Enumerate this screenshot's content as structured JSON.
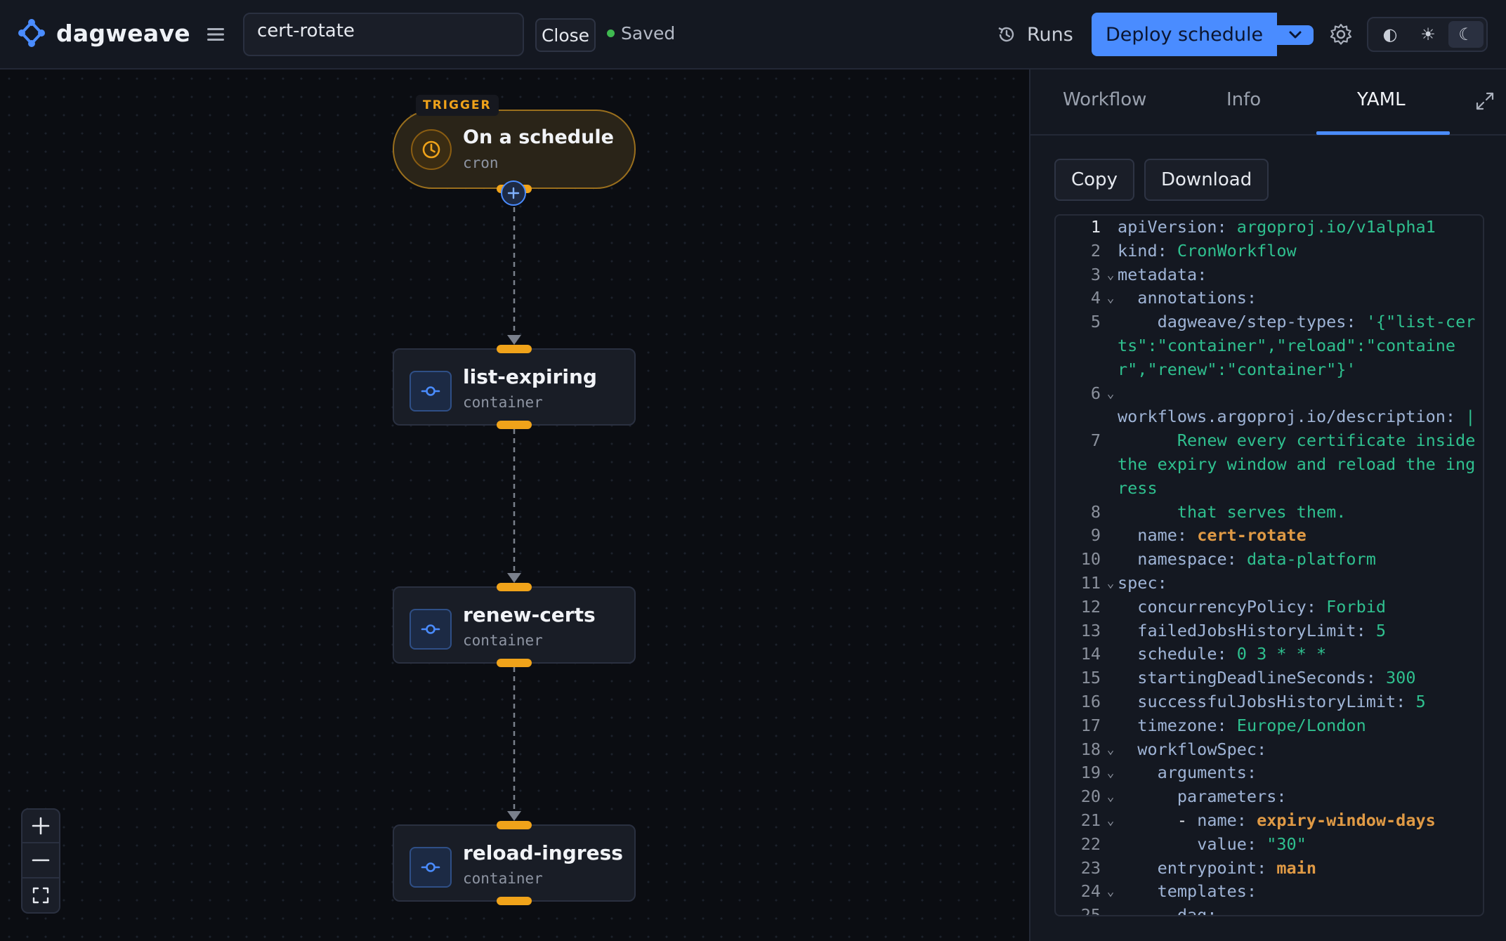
{
  "header": {
    "app_name": "dagweave",
    "workflow_name": "cert-rotate",
    "close_label": "Close",
    "save_status": "Saved",
    "runs_label": "Runs",
    "deploy_label": "Deploy schedule",
    "theme_options": [
      "contrast",
      "light",
      "dark"
    ],
    "theme_glyphs": [
      "◐",
      "☀",
      "☾"
    ]
  },
  "canvas": {
    "trigger": {
      "badge": "TRIGGER",
      "title": "On a schedule",
      "subtitle": "cron"
    },
    "nodes": [
      {
        "title": "list-expiring",
        "subtitle": "container"
      },
      {
        "title": "renew-certs",
        "subtitle": "container"
      },
      {
        "title": "reload-ingress",
        "subtitle": "container"
      }
    ]
  },
  "panel": {
    "tabs": [
      "Workflow",
      "Info",
      "YAML"
    ],
    "active_tab": "YAML",
    "copy_label": "Copy",
    "download_label": "Download",
    "yaml_lines": [
      {
        "n": "1",
        "fold": false,
        "text": "apiVersion: argoproj.io/v1alpha1"
      },
      {
        "n": "2",
        "fold": false,
        "text": "kind: CronWorkflow"
      },
      {
        "n": "3",
        "fold": true,
        "text": "metadata:"
      },
      {
        "n": "4",
        "fold": true,
        "text": "  annotations:"
      },
      {
        "n": "5",
        "fold": false,
        "text": "    dagweave/step-types: '{\"list-certs\":\"container\",\"reload\":\"container\",\"renew\":\"container\"}'"
      },
      {
        "n": "6",
        "fold": true,
        "text": ""
      },
      {
        "n": "",
        "fold": false,
        "text": "workflows.argoproj.io/description: |"
      },
      {
        "n": "7",
        "fold": false,
        "text": "      Renew every certificate inside the expiry window and reload the ingress"
      },
      {
        "n": "8",
        "fold": false,
        "text": "      that serves them."
      },
      {
        "n": "9",
        "fold": false,
        "text": "  name: cert-rotate"
      },
      {
        "n": "10",
        "fold": false,
        "text": "  namespace: data-platform"
      },
      {
        "n": "11",
        "fold": true,
        "text": "spec:"
      },
      {
        "n": "12",
        "fold": false,
        "text": "  concurrencyPolicy: Forbid"
      },
      {
        "n": "13",
        "fold": false,
        "text": "  failedJobsHistoryLimit: 5"
      },
      {
        "n": "14",
        "fold": false,
        "text": "  schedule: 0 3 * * *"
      },
      {
        "n": "15",
        "fold": false,
        "text": "  startingDeadlineSeconds: 300"
      },
      {
        "n": "16",
        "fold": false,
        "text": "  successfulJobsHistoryLimit: 5"
      },
      {
        "n": "17",
        "fold": false,
        "text": "  timezone: Europe/London"
      },
      {
        "n": "18",
        "fold": true,
        "text": "  workflowSpec:"
      },
      {
        "n": "19",
        "fold": true,
        "text": "    arguments:"
      },
      {
        "n": "20",
        "fold": true,
        "text": "      parameters:"
      },
      {
        "n": "21",
        "fold": true,
        "text": "      - name: expiry-window-days"
      },
      {
        "n": "22",
        "fold": false,
        "text": "        value: \"30\""
      },
      {
        "n": "23",
        "fold": false,
        "text": "    entrypoint: main"
      },
      {
        "n": "24",
        "fold": true,
        "text": "    templates:"
      },
      {
        "n": "25",
        "fold": false,
        "text": "    - dag:"
      }
    ],
    "anchor_values": [
      "cert-rotate",
      "expiry-window-days",
      "main"
    ]
  },
  "colors": {
    "accent": "#4a8cff",
    "handle": "#f0a31a",
    "status_ok": "#3fb950",
    "yaml_key": "#9fb4d6",
    "yaml_string": "#2fc08f",
    "yaml_anchor": "#e09a45"
  }
}
